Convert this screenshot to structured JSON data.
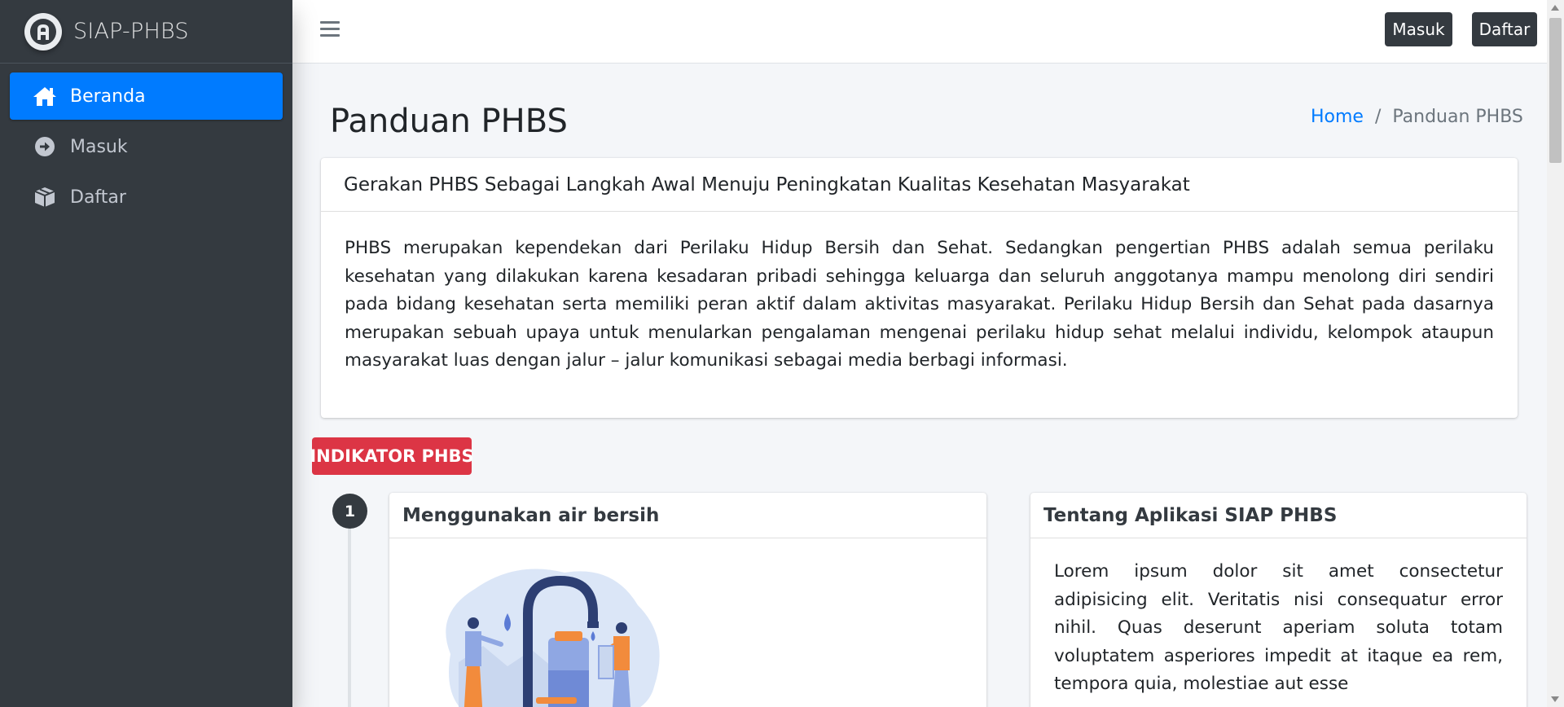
{
  "brand": {
    "name": "SIAP-PHBS",
    "logo_icon": "app-logo-icon"
  },
  "sidebar": {
    "items": [
      {
        "label": "Beranda",
        "icon": "home-icon",
        "active": true
      },
      {
        "label": "Masuk",
        "icon": "arrow-circle-right-icon",
        "active": false
      },
      {
        "label": "Daftar",
        "icon": "box-icon",
        "active": false
      }
    ]
  },
  "navbar": {
    "menu_icon": "hamburger-icon",
    "login_label": "Masuk",
    "register_label": "Daftar"
  },
  "page": {
    "title": "Panduan PHBS",
    "breadcrumb": {
      "home": "Home",
      "separator": "/",
      "current": "Panduan PHBS"
    }
  },
  "intro_card": {
    "header": "Gerakan PHBS Sebagai Langkah Awal Menuju Peningkatan Kualitas Kesehatan Masyarakat",
    "body": "PHBS merupakan kependekan dari Perilaku Hidup Bersih dan Sehat. Sedangkan pengertian PHBS adalah semua perilaku kesehatan yang dilakukan karena kesadaran pribadi sehingga keluarga dan seluruh anggotanya mampu menolong diri sendiri pada bidang kesehatan serta memiliki peran aktif dalam aktivitas masyarakat. Perilaku Hidup Bersih dan Sehat pada dasarnya merupakan sebuah upaya untuk menularkan pengalaman mengenai perilaku hidup sehat melalui individu, kelompok ataupun masyarakat luas dengan jalur – jalur komunikasi sebagai media berbagi informasi."
  },
  "indikator": {
    "badge": "INDIKATOR PHBS",
    "items": [
      {
        "number": "1",
        "title": "Menggunakan air bersih"
      }
    ]
  },
  "about_card": {
    "header": "Tentang Aplikasi SIAP PHBS",
    "body": "Lorem ipsum dolor sit amet consectetur adipisicing elit. Veritatis nisi consequatur error nihil. Quas deserunt aperiam soluta totam voluptatem asperiores impedit at itaque ea rem, tempora quia, molestiae aut esse"
  },
  "colors": {
    "sidebar_bg": "#343a40",
    "primary": "#007bff",
    "danger": "#dc3545",
    "content_bg": "#f4f6f9"
  }
}
